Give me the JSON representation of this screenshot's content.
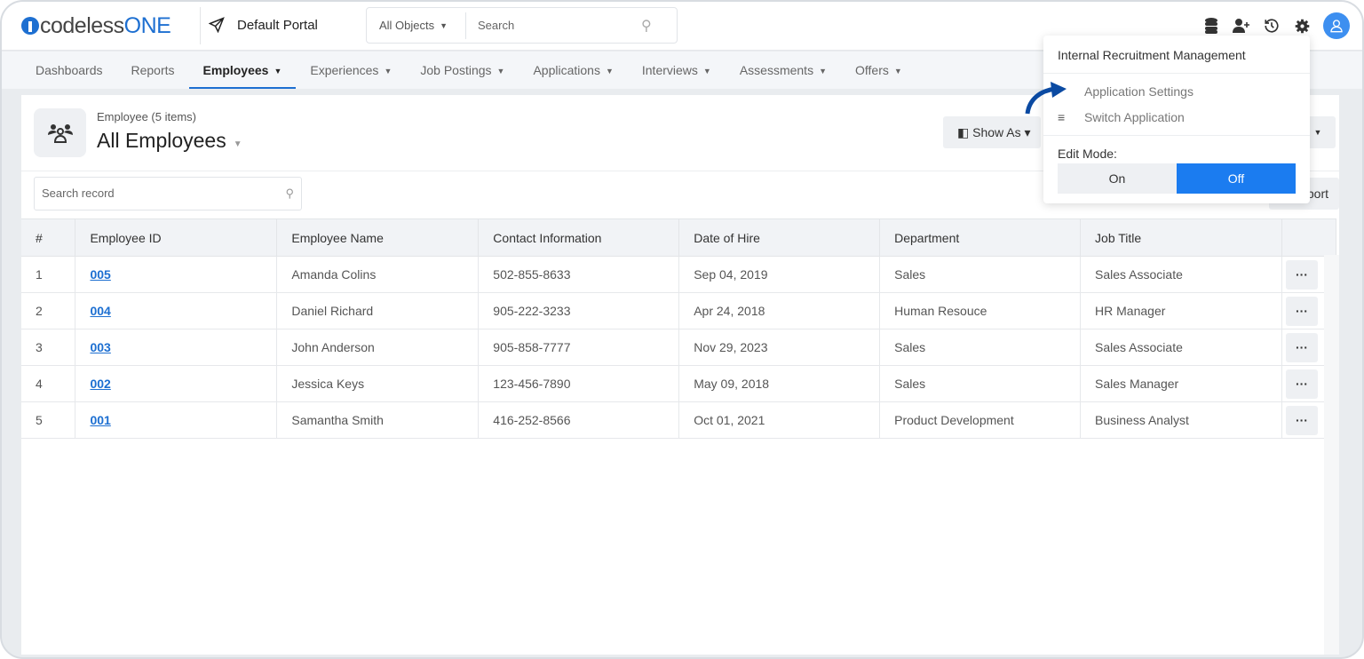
{
  "header": {
    "logo": "codelessONE",
    "portal": "Default Portal",
    "search_scope": "All Objects",
    "search_placeholder": "Search"
  },
  "nav": [
    {
      "label": "Dashboards",
      "dropdown": false
    },
    {
      "label": "Reports",
      "dropdown": false
    },
    {
      "label": "Employees",
      "dropdown": true,
      "active": true
    },
    {
      "label": "Experiences",
      "dropdown": true
    },
    {
      "label": "Job Postings",
      "dropdown": true
    },
    {
      "label": "Applications",
      "dropdown": true
    },
    {
      "label": "Interviews",
      "dropdown": true
    },
    {
      "label": "Assessments",
      "dropdown": true
    },
    {
      "label": "Offers",
      "dropdown": true
    }
  ],
  "view": {
    "subtitle": "Employee (5 items)",
    "title": "All Employees",
    "show_as": "Show As",
    "search_placeholder": "Search record",
    "export_label": "port"
  },
  "table": {
    "columns": [
      "#",
      "Employee ID",
      "Employee Name",
      "Contact Information",
      "Date of Hire",
      "Department",
      "Job Title"
    ],
    "rows": [
      [
        "1",
        "005",
        "Amanda Colins",
        "502-855-8633",
        "Sep 04, 2019",
        "Sales",
        "Sales Associate"
      ],
      [
        "2",
        "004",
        "Daniel Richard",
        "905-222-3233",
        "Apr 24, 2018",
        "Human Resouce",
        "HR Manager"
      ],
      [
        "3",
        "003",
        "John Anderson",
        "905-858-7777",
        "Nov 29, 2023",
        "Sales",
        "Sales Associate"
      ],
      [
        "4",
        "002",
        "Jessica Keys",
        "123-456-7890",
        "May 09, 2018",
        "Sales",
        "Sales Manager"
      ],
      [
        "5",
        "001",
        "Samantha Smith",
        "416-252-8566",
        "Oct 01, 2021",
        "Product Development",
        "Business Analyst"
      ]
    ],
    "more_label": "···"
  },
  "dropdown": {
    "title": "Internal Recruitment Management",
    "items": [
      "Application Settings",
      "Switch Application"
    ],
    "edit_mode_label": "Edit Mode:",
    "on": "On",
    "off": "Off",
    "selected": "Off"
  },
  "colors": {
    "accent": "#1d6fd1",
    "toggle_active": "#1b7cf0",
    "arrow": "#0b4aa2"
  }
}
